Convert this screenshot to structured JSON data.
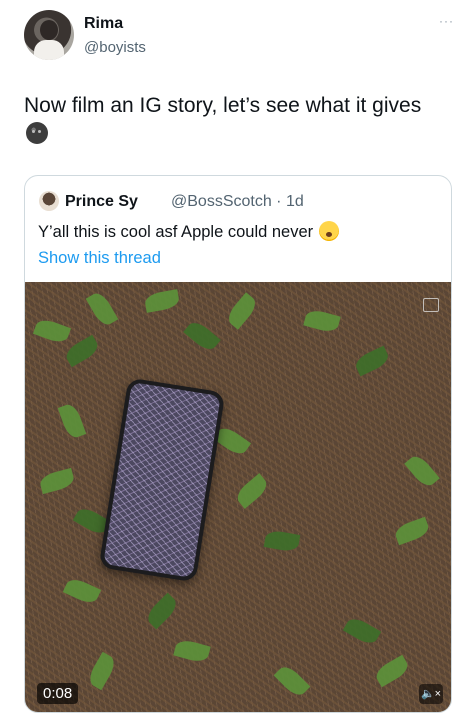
{
  "author": {
    "name": "Rima",
    "handle": "@boyists",
    "more_label": "···"
  },
  "tweet": {
    "text": "Now film an IG story, let’s see what it gives",
    "emoji": "new-moon-face-emoji"
  },
  "quoted": {
    "name": "Prince Sy",
    "handle": "@BossScotch · 1d",
    "text": "Y’all this is cool asf Apple could never",
    "emoji": "sweat-face-emoji",
    "show_thread": "Show this thread"
  },
  "video": {
    "timestamp": "0:08",
    "mute_label": "🔈×"
  },
  "colors": {
    "link": "#1d9bf0",
    "secondary_text": "#536471",
    "border": "#cfd9de"
  }
}
